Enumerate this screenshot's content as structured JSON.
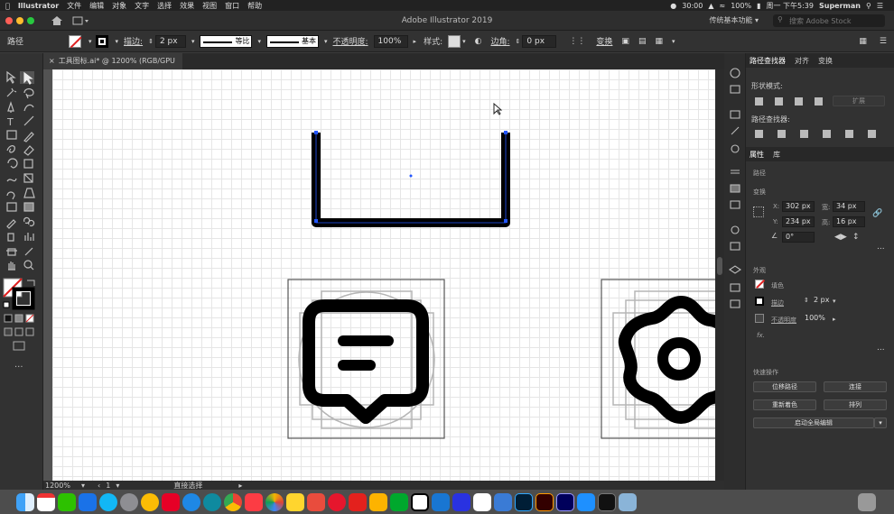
{
  "menubar": {
    "apple_icon": "apple-icon",
    "app_name": "Illustrator",
    "items": [
      "文件",
      "编辑",
      "对象",
      "文字",
      "选择",
      "效果",
      "视图",
      "窗口",
      "帮助"
    ],
    "time": "30:00",
    "battery": "100%",
    "clock": "周一 下午5:39",
    "user": "Superman"
  },
  "titlebar": {
    "title": "Adobe Illustrator 2019",
    "workspace": "传统基本功能",
    "search_placeholder": "搜索 Adobe Stock"
  },
  "control": {
    "object_type": "路径",
    "stroke_label": "描边:",
    "stroke_weight": "2 px",
    "profile_label": "等比",
    "brush_label": "基本",
    "opacity_label": "不透明度:",
    "opacity_value": "100%",
    "style_label": "样式:",
    "corner_label": "边角:",
    "corner_value": "0 px",
    "transform_label": "变换"
  },
  "document": {
    "tab_title": "工具图标.ai* @ 1200% (RGB/GPU 预览)",
    "zoom": "1200%",
    "artboard_num": "1",
    "status": "直接选择"
  },
  "panels": {
    "top_tabs": [
      "路径查找器",
      "对齐",
      "变换"
    ],
    "shape_modes_label": "形状模式:",
    "expand_label": "扩展",
    "pathfinder_label": "路径查找器:",
    "prop_tabs": [
      "属性",
      "库"
    ],
    "path_label": "路径",
    "transform_label": "变换",
    "x_label": "X:",
    "x_value": "302 px",
    "y_label": "Y:",
    "y_value": "234 px",
    "w_label": "宽:",
    "w_value": "34 px",
    "h_label": "高:",
    "h_value": "16 px",
    "angle_value": "0°",
    "appearance_label": "外观",
    "fill_label": "填色",
    "stroke_label": "描边",
    "stroke_value": "2 px",
    "opacity_label": "不透明度",
    "opacity_value": "100%",
    "fx_label": "fx.",
    "quick_actions_label": "快速操作",
    "btn_offset_path": "位移路径",
    "btn_join": "连接",
    "btn_recolor": "重新着色",
    "btn_arrange": "排列",
    "btn_global_edit": "启动全局编辑"
  },
  "dock_apps": [
    "finder-icon",
    "calendar-icon",
    "wechat-icon",
    "tasks-icon",
    "qq-icon",
    "launchpad-icon",
    "chrome-canary-icon",
    "netease-music-icon",
    "safari-icon",
    "edge-icon",
    "chrome-icon",
    "music-icon",
    "photos-icon",
    "notes-icon",
    "mindnode-icon",
    "weibo-icon",
    "youdao-icon",
    "sketch-icon",
    "evernote-icon",
    "notion-icon",
    "screen-icon",
    "baidu-icon",
    "typora-icon",
    "feather-icon",
    "ps-icon",
    "ai-icon",
    "ae-icon",
    "appstore-icon",
    "terminal-icon",
    "preview-icon",
    "trash-icon"
  ],
  "colors": {
    "accent": "#1473e6",
    "ps": "#31a8ff",
    "ai": "#ff9a00",
    "ae": "#9999ff"
  }
}
